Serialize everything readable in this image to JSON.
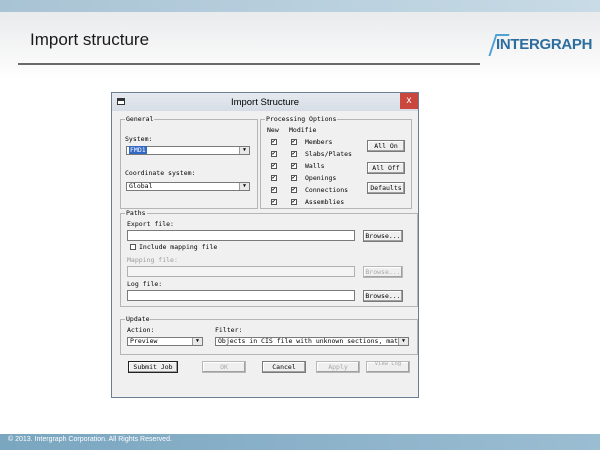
{
  "slide": {
    "title": "Import structure",
    "logo": "INTERGRAPH",
    "footer": "© 2013. Intergraph Corporation. All Rights Reserved."
  },
  "dialog": {
    "title": "Import Structure",
    "close_label": "x",
    "general": {
      "group_label": "General",
      "system_label": "System:",
      "system_value": "FMD1",
      "coord_label": "Coordinate system:",
      "coord_value": "Global"
    },
    "processing": {
      "group_label": "Processing Options",
      "col_new": "New",
      "col_modified": "Modifie",
      "rows": [
        {
          "label": "Members",
          "new": true,
          "modified": true
        },
        {
          "label": "Slabs/Plates",
          "new": true,
          "modified": true
        },
        {
          "label": "Walls",
          "new": true,
          "modified": true
        },
        {
          "label": "Openings",
          "new": true,
          "modified": true
        },
        {
          "label": "Connections",
          "new": true,
          "modified": true
        },
        {
          "label": "Assemblies",
          "new": true,
          "modified": true
        }
      ],
      "all_on": "All On",
      "all_off": "All Off",
      "defaults": "Defaults"
    },
    "paths": {
      "group_label": "Paths",
      "export_label": "Export file:",
      "export_value": "",
      "browse1": "Browse...",
      "include_mapping": "Include mapping file",
      "include_mapping_checked": false,
      "mapping_label": "Mapping file:",
      "browse2": "Browse...",
      "log_label": "Log file:",
      "log_value": "",
      "browse3": "Browse..."
    },
    "update": {
      "group_label": "Update",
      "action_label": "Action:",
      "action_value": "Preview",
      "filter_label": "Filter:",
      "filter_value": "Objects in CIS file with unknown sections, materi"
    },
    "buttons": {
      "submit": "Submit Job",
      "ok": "OK",
      "cancel": "Cancel",
      "apply": "Apply",
      "view_log": "View Log"
    }
  }
}
